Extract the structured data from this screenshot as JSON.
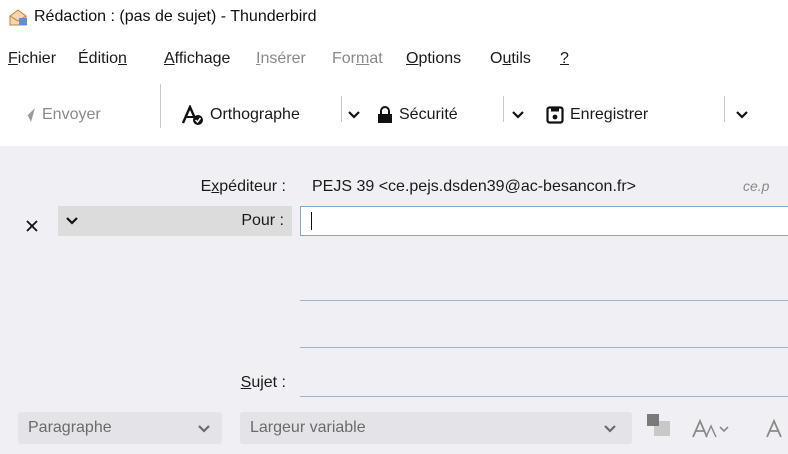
{
  "window": {
    "title": "Rédaction : (pas de sujet) - Thunderbird"
  },
  "menu": [
    {
      "pre": "",
      "key": "F",
      "post": "ichier",
      "disabled": false
    },
    {
      "pre": "Éditio",
      "key": "n",
      "post": "",
      "disabled": false
    },
    {
      "pre": "",
      "key": "A",
      "post": "ffichage",
      "disabled": false
    },
    {
      "pre": "",
      "key": "I",
      "post": "nsérer",
      "disabled": true
    },
    {
      "pre": "For",
      "key": "m",
      "post": "at",
      "disabled": true
    },
    {
      "pre": "",
      "key": "O",
      "post": "ptions",
      "disabled": false
    },
    {
      "pre": "O",
      "key": "u",
      "post": "tils",
      "disabled": false
    },
    {
      "pre": "",
      "key": "?",
      "post": "",
      "disabled": false
    }
  ],
  "toolbar": {
    "send_label": "Envoyer",
    "spell_label": "Orthographe",
    "security_label": "Sécurité",
    "save_label": "Enregistrer"
  },
  "header": {
    "from_label_pre": "E",
    "from_label_key": "x",
    "from_label_post": "péditeur :",
    "from_value": "PEJS 39 <ce.pejs.dsden39@ac-besancon.fr>",
    "from_extra": "ce.p",
    "to_label": "Pour :",
    "to_value": "",
    "subject_label_key": "S",
    "subject_label_post": "ujet :",
    "subject_value": ""
  },
  "format": {
    "paragraph_value": "Paragraphe",
    "font_value": "Largeur variable"
  },
  "colors": {
    "accent_border": "#7fa8d8",
    "header_bg": "#f0f0f4",
    "disabled_text": "#8a8a8a"
  }
}
